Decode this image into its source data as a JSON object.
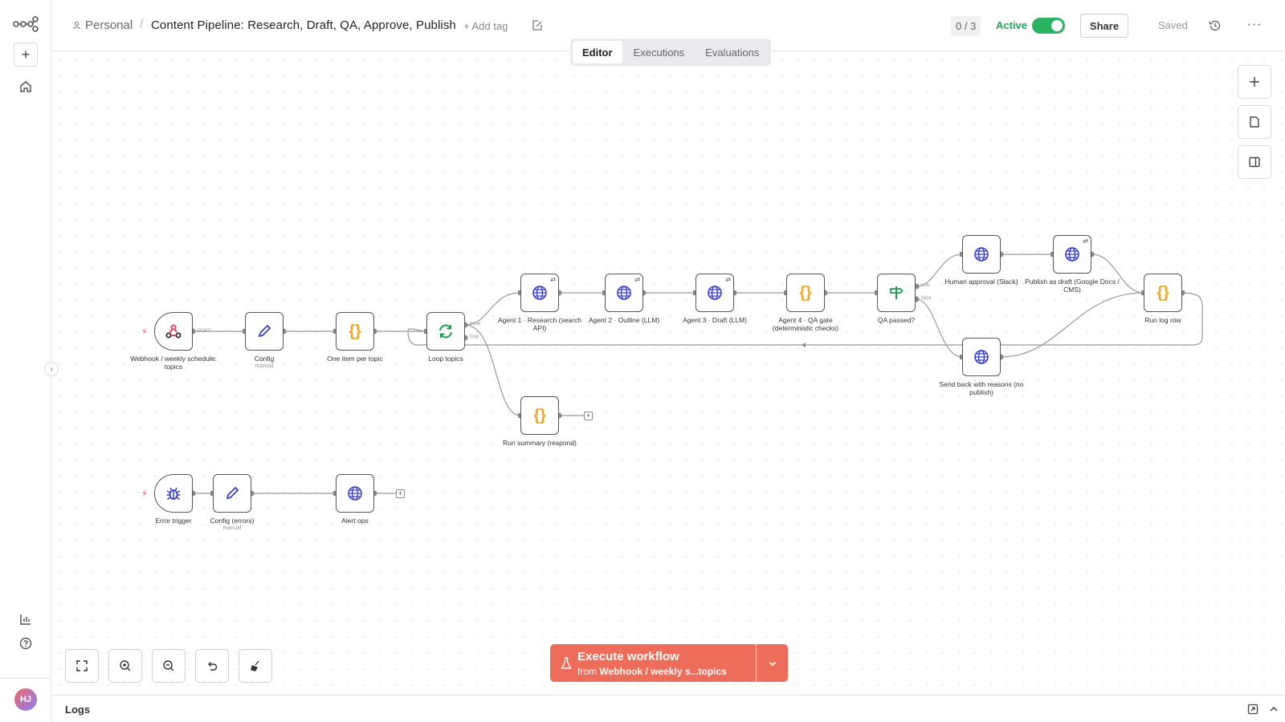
{
  "header": {
    "project": "Personal",
    "separator": "/",
    "workflow_name": "Content Pipeline: Research, Draft, QA, Approve, Publish",
    "add_tag": "+ Add tag",
    "counter": "0 / 3",
    "active_label": "Active",
    "active": true,
    "share_label": "Share",
    "saved_label": "Saved"
  },
  "tabs": [
    {
      "label": "Editor",
      "active": true
    },
    {
      "label": "Executions",
      "active": false
    },
    {
      "label": "Evaluations",
      "active": false
    }
  ],
  "rail": {
    "avatar_initials": "HJ"
  },
  "nodes": {
    "webhook": {
      "label": "Webhook / weekly schedule: topics",
      "port": "POST"
    },
    "config": {
      "label": "Config",
      "sub": "manual"
    },
    "one_item": {
      "label": "One item per topic"
    },
    "loop": {
      "label": "Loop topics",
      "port_done": "done",
      "port_loop": "loop"
    },
    "agent1": {
      "label": "Agent 1 · Research (search API)"
    },
    "agent2": {
      "label": "Agent 2 · Outline (LLM)"
    },
    "agent3": {
      "label": "Agent 3 · Draft (LLM)"
    },
    "agent4": {
      "label": "Agent 4 · QA gate (deterministic checks)"
    },
    "qa": {
      "label": "QA passed?",
      "port_true": "true",
      "port_false": "false"
    },
    "approval": {
      "label": "Human approval (Slack)"
    },
    "publish": {
      "label": "Publish as draft (Google Docs / CMS)"
    },
    "sendback": {
      "label": "Send back with reasons (no publish)"
    },
    "runlog": {
      "label": "Run log row"
    },
    "summary": {
      "label": "Run summary (respond)"
    },
    "errtrig": {
      "label": "Error trigger"
    },
    "errconfig": {
      "label": "Config (errors)",
      "sub": "manual"
    },
    "alert": {
      "label": "Alert ops"
    }
  },
  "execute": {
    "title": "Execute workflow",
    "from": "from",
    "source": "Webhook / weekly s...topics"
  },
  "logs": {
    "label": "Logs"
  },
  "colors": {
    "accent": "#ee6d5a",
    "active_green": "#28b463",
    "globe": "#3b3fc6",
    "code": "#f5a524",
    "loop": "#1f9d55",
    "webhook": "#e04a6a"
  }
}
